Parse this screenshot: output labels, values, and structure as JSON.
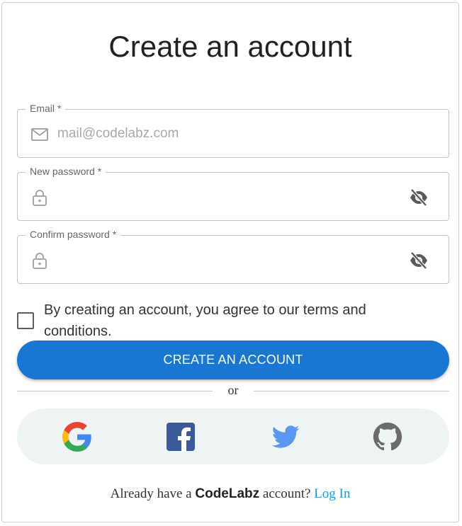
{
  "title": "Create an account",
  "email": {
    "label": "Email *",
    "placeholder": "mail@codelabz.com",
    "value": ""
  },
  "new_password": {
    "label": "New password *",
    "value": ""
  },
  "confirm_password": {
    "label": "Confirm password *",
    "value": ""
  },
  "terms_text": "By creating an account, you agree to our terms and conditions.",
  "create_button_label": "CREATE AN ACCOUNT",
  "divider_text": "or",
  "social_buttons": [
    "google-icon",
    "facebook-icon",
    "twitter-icon",
    "github-icon"
  ],
  "footer": {
    "prefix": "Already have a",
    "brand": "CodeLabz",
    "suffix": "account?",
    "login_link": "Log In"
  },
  "colors": {
    "primary": "#1976d2",
    "link": "#1a9be0",
    "social_bg": "#eef3f4",
    "facebook": "#3b5998",
    "twitter": "#5b96f0",
    "github": "#6b6b6b"
  }
}
